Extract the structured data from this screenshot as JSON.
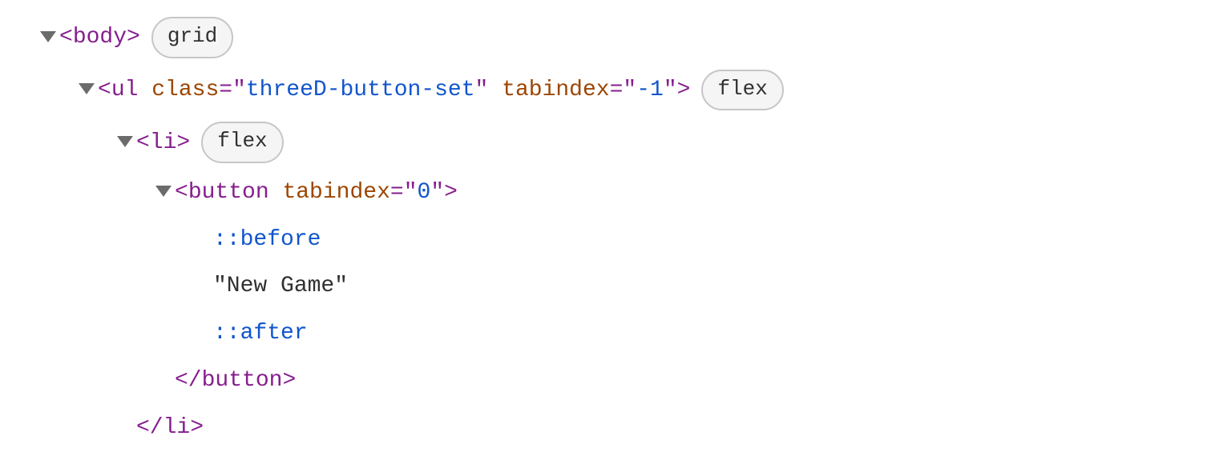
{
  "tree": {
    "line1": {
      "tag": "body",
      "badge": "grid"
    },
    "line2": {
      "tag": "ul",
      "attr1_name": "class",
      "attr1_value": "threeD-button-set",
      "attr2_name": "tabindex",
      "attr2_value": "-1",
      "badge": "flex"
    },
    "line3": {
      "tag": "li",
      "badge": "flex"
    },
    "line4": {
      "tag": "button",
      "attr1_name": "tabindex",
      "attr1_value": "0"
    },
    "line5": {
      "pseudo": "::before"
    },
    "line6": {
      "text": "\"New Game\""
    },
    "line7": {
      "pseudo": "::after"
    },
    "line8": {
      "close_tag": "button"
    },
    "line9": {
      "close_tag": "li"
    }
  }
}
